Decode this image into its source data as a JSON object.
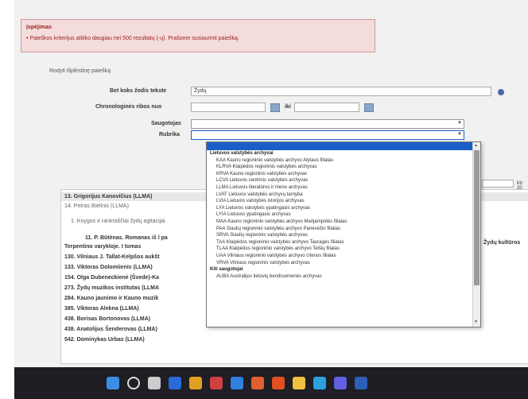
{
  "alert": {
    "title": "Įspėjimas",
    "message": "• Paieškos kriterijus atitiko daugiau nei 500 rezultatų (-ų). Prašome susiaurinti paiešką."
  },
  "form": {
    "caption": "Rodyti išplėstinę paiešką",
    "any_word_label": "Bet koks žodis tekste",
    "any_word_value": "Žydų",
    "date_label": "Chronologinės ribos nuo",
    "date_to_label": "iki",
    "keeper_label": "Saugotojas",
    "rubric_label": "Rubrika"
  },
  "dropdown": {
    "items": [
      {
        "text": "Lietuvos valstybės archyvai",
        "group": true
      },
      {
        "text": "KAA Kauno regioninio valstybės archyvo Alytaus filialas",
        "group": false
      },
      {
        "text": "KLRVA Klaipėdos regioninis valstybės archyvas",
        "group": false
      },
      {
        "text": "KRVA Kauno regioninis valstybės archyvas",
        "group": false
      },
      {
        "text": "LCVA Lietuvos centrinis valstybės archyvas",
        "group": false
      },
      {
        "text": "LLMA Lietuvos literatūros ir meno archyvas",
        "group": false
      },
      {
        "text": "LVAT Lietuvos valstybės archyvų tarnyba",
        "group": false
      },
      {
        "text": "LVIA Lietuvos valstybės istorijos archyvas",
        "group": false
      },
      {
        "text": "LYA Lietuvos valstybės ypatingasis archyvas",
        "group": false
      },
      {
        "text": "LYIA Lietuvos ypatingasis archyvas",
        "group": false
      },
      {
        "text": "MAA Kauno regioninio valstybės archyvo Marijampolės filialas",
        "group": false
      },
      {
        "text": "PAA Šiaulių regioninio valstybės archyvo Panevėžio filialas",
        "group": false
      },
      {
        "text": "ŠRVA Šiaulių regioninis valstybės archyvas",
        "group": false
      },
      {
        "text": "TAA Klaipėdos regioninio valstybės archyvo Tauragės filialas",
        "group": false
      },
      {
        "text": "TLAA Klaipėdos regioninio valstybės archyvo Telšių filialas",
        "group": false
      },
      {
        "text": "UAA Vilniaus regioninio valstybės archyvo Utenos filialas",
        "group": false
      },
      {
        "text": "VRVA Vilniaus regioninis valstybės archyvas",
        "group": false
      },
      {
        "text": "Kiti saugotojai",
        "group": true
      },
      {
        "text": "AUBA Australijos lietuvių bendruomenės archyvas",
        "group": false
      }
    ]
  },
  "results": {
    "rows": [
      {
        "text": "13. Grigorijus Kanovičius (LLMA)",
        "light": false
      },
      {
        "text": "14. Petras Bielinis (LLMA)",
        "light": true
      },
      {
        "text": "1. Knygos ir rankraščiai žydų agitacijai",
        "light": true
      },
      {
        "text": "11. P. Būtėnas. Romanas iš l pa",
        "light": false
      },
      {
        "text": "Terpentino varykloje. I tomas",
        "light": false
      },
      {
        "text": "130. Vilniaus J. Tallat-Kelpšos aukšt",
        "light": false
      },
      {
        "text": "133. Viktoras Dolomiienis (LLMA)",
        "light": false
      },
      {
        "text": "154. Olga Dubeneckienė (Švede)-Ka",
        "light": false
      },
      {
        "text": "273. Žydų muzikos institutas (LLMA",
        "light": false
      },
      {
        "text": "284. Kauno jaunimo ir Kauno muzik",
        "light": false
      },
      {
        "text": "385. Viktoras Alekna (LLMA)",
        "light": false
      },
      {
        "text": "438. Borisas Bortonovas (LLMA)",
        "light": false
      },
      {
        "text": "438. Anatolijus Šenderovas (LLMA)",
        "light": false
      },
      {
        "text": "542. Dominykas Urbas (LLMA)",
        "light": false
      }
    ],
    "page_size_value": "",
    "side_label": "Kit 20",
    "side_heading": "Žydų kultūros"
  },
  "colors": {
    "accent": "#1a5fc8",
    "alert_bg": "#f4dcdc",
    "alert_text": "#a02020"
  },
  "taskbar": {
    "icons": [
      "windows-start-icon",
      "search-icon",
      "task-view-icon",
      "meet-icon",
      "chrome-icon",
      "media-icon",
      "edge-icon",
      "office-icon",
      "firefox-icon",
      "file-explorer-icon",
      "skype-icon",
      "app-icon",
      "word-icon"
    ]
  }
}
